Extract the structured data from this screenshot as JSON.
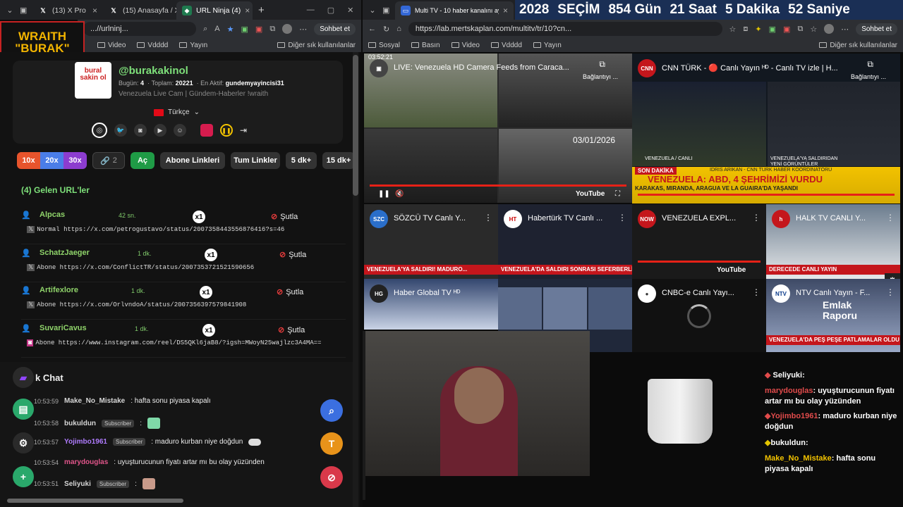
{
  "left_browser": {
    "tabs": [
      {
        "label": "(13) X Pro"
      },
      {
        "label": "(15) Anasayfa / X"
      },
      {
        "label": "URL Ninja (4)"
      }
    ],
    "url": "...//urlninj...",
    "sohbet_label": "Sohbet et",
    "bookmarks": [
      "Video",
      "Vdddd",
      "Yayın"
    ],
    "other_bookmarks": "Diğer sık kullanılanlar"
  },
  "overlay_logo": {
    "line1": "WRAITH",
    "line2": "\"BURAK\""
  },
  "profile": {
    "logo_text": "bural sakin ol",
    "handle": "@burakakinol",
    "stats_today_label": "Bugün:",
    "stats_today": "4",
    "stats_total_label": "Toplam:",
    "stats_total": "20221",
    "stats_active_label": "En Aktif:",
    "stats_active": "gundemyayincisi31",
    "subtitle": "Venezuela Live Cam | Gündem-Haberler !wraith",
    "language": "Türkçe"
  },
  "controls": {
    "speed_10x": "10x",
    "speed_20x": "20x",
    "speed_30x": "30x",
    "link_count": "2",
    "open_label": "Aç",
    "subscriber_links": "Abone Linkleri",
    "all_links": "Tum Linkler",
    "k5": "5 dk+",
    "k15": "15 dk+"
  },
  "incoming_header": "(4) Gelen URL'ler",
  "kick_label": "Şutla",
  "urls": [
    {
      "user": "Alpcas",
      "time": "42 sn.",
      "count": "x1",
      "link": "Normal https://x.com/petrogustavo/status/2007358443556876416?s=46"
    },
    {
      "user": "SchatzJaeger",
      "time": "1 dk.",
      "count": "x1",
      "link": "Abone https://x.com/ConflictTR/status/2007353721521590656"
    },
    {
      "user": "Artifexlore",
      "time": "1 dk.",
      "count": "x1",
      "link": "Abone https://x.com/OrlvndoA/status/2007356397579841908"
    },
    {
      "user": "SuvariCavus",
      "time": "1 dk.",
      "count": "x1",
      "link": "Abone https://www.instagram.com/reel/DS5QKl6jaB8/?igsh=MWoyN25wajlzc3A4MA=="
    }
  ],
  "chat_title": "k Chat",
  "chat": [
    {
      "time": "10:53:59",
      "user": "Make_No_Mistake",
      "badge": "",
      "msg": ": hafta sonu piyasa kapalı",
      "color": "#d6d6d6"
    },
    {
      "time": "10:53:58",
      "user": "bukuldun",
      "badge": "Subscriber",
      "msg": ":",
      "color": "#d6d6d6"
    },
    {
      "time": "10:53:57",
      "user": "Yojimbo1961",
      "badge": "Subscriber",
      "msg": ": maduro kurban niye doğdun",
      "color": "#b07cff"
    },
    {
      "time": "10:53:54",
      "user": "marydouglas",
      "badge": "",
      "msg": ": uyuşturucunun fiyatı artar mı bu olay yüzünden",
      "color": "#e0558a"
    },
    {
      "time": "10:53:51",
      "user": "Seliyuki",
      "badge": "Subscriber",
      "msg": ":",
      "color": "#d6d6d6"
    }
  ],
  "right_browser": {
    "tab": "Multi TV - 10 haber kanalını aynı a",
    "url": "https://lab.mertskaplan.com/multitv/tr/10?cn...",
    "sohbet_label": "Sohbet et",
    "bookmarks": [
      "Sosyal",
      "Basın",
      "Video",
      "Vdddd",
      "Yayın"
    ],
    "other_bookmarks": "Diğer sık kullanılanlar"
  },
  "countdown": {
    "year": "2028",
    "label": "SEÇİM",
    "days": "854",
    "days_l": "Gün",
    "hours": "21",
    "hours_l": "Saat",
    "mins": "5",
    "mins_l": "Dakika",
    "secs": "52",
    "secs_l": "Saniye"
  },
  "videos": [
    {
      "title": "LIVE: Venezuela HD Camera Feeds from Caraca...",
      "logo": "",
      "overlay": "Bağlantıyı ...",
      "clock": "03:52:21",
      "date": "03/01/2026"
    },
    {
      "title": "CNN TÜRK - 🔴 Canlı Yayın ᴴᴰ - Canlı TV izle | H...",
      "logo": "CNN",
      "overlay": "Bağlantıyı ...",
      "caption1": "VENEZUELA / CANLI",
      "caption2": "VENEZUELA'YA SALDIRIDAN YENİ GÖRÜNTÜLER"
    },
    {
      "title": "SÖZCÜ TV Canlı Y...",
      "logo": "SZC",
      "ticker": "VENEZUELA'YA SALDIRI! MADURO..."
    },
    {
      "title": "Habertürk TV Canlı ...",
      "logo": "HT",
      "ticker": "VENEZUELA'DA SALDIRI SONRASI SEFERBERLİK"
    },
    {
      "title": "VENEZUELA EXPL...",
      "logo": "NOW",
      "ticker": ""
    },
    {
      "title": "HALK TV CANLI Y...",
      "logo": "h",
      "ticker": "DERECEDE CANLI YAYIN"
    },
    {
      "title": "Haber Global TV ᴴᴰ",
      "logo": "HG",
      "ticker": ""
    },
    {
      "title": "CNBC-e Canlı Yayı...",
      "logo": "",
      "ticker": ""
    },
    {
      "title": "NTV Canlı Yayın - F...",
      "logo": "NTV",
      "caption": "Emlak Raporu",
      "ticker": "VENEZUELA'DA PEŞ PEŞE PATLAMALAR OLDU"
    }
  ],
  "breaking": {
    "tag": "SON DAKİKA",
    "text": "VENEZUELA: ABD, 4 ŞEHRİMİZİ VURDU",
    "sub": "KARAKAS, MIRANDA, ARAGUA VE LA GUAIRA'DA YAŞANDI",
    "reporter": "İDRİS ARIKAN - CNN TÜRK HABER KOORDİNATÖRÜ"
  },
  "stream_chat": [
    {
      "user": "Seliyuki",
      "msg": ""
    },
    {
      "user": "marydouglas",
      "msg": "uyuşturucunun fiyatı artar mı bu olay yüzünden"
    },
    {
      "user": "Yojimbo1961",
      "msg": "maduro kurban niye doğdun"
    },
    {
      "user": "bukuldun",
      "msg": ""
    },
    {
      "user": "Make_No_Mistake",
      "msg": "hafta sonu piyasa kapalı"
    }
  ]
}
